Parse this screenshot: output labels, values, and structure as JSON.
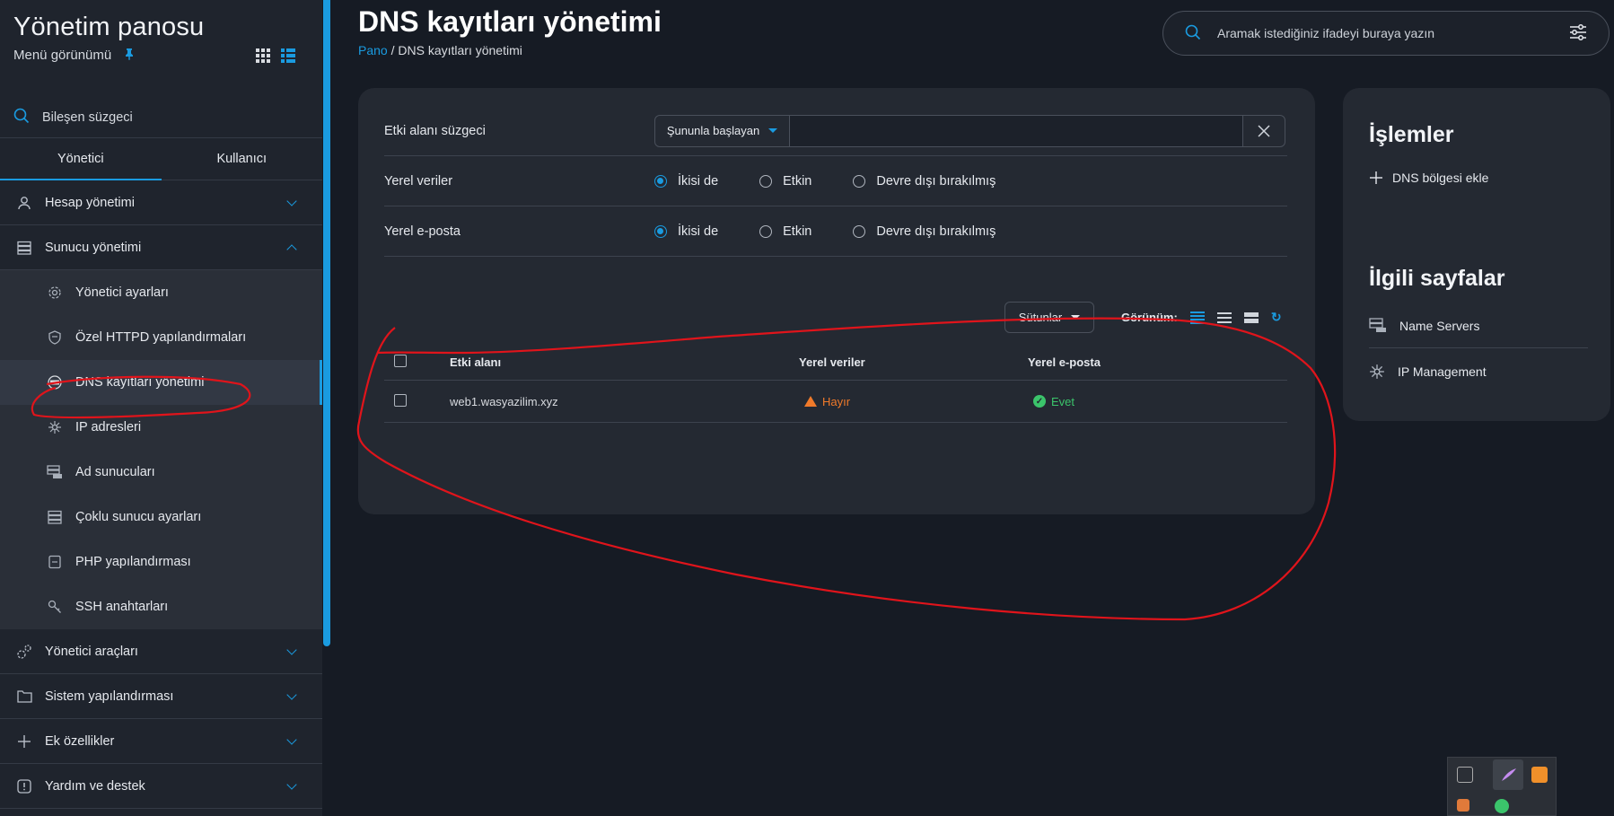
{
  "sidebar": {
    "title": "Yönetim panosu",
    "subtitle": "Menü görünümü",
    "filter_label": "Bileşen süzgeci",
    "tabs": [
      {
        "label": "Yönetici"
      },
      {
        "label": "Kullanıcı"
      }
    ],
    "sections_top": [
      {
        "label": "Hesap yönetimi"
      },
      {
        "label": "Sunucu yönetimi"
      }
    ],
    "sub_items": [
      {
        "label": "Yönetici ayarları"
      },
      {
        "label": "Özel HTTPD yapılandırmaları"
      },
      {
        "label": "DNS kayıtları yönetimi"
      },
      {
        "label": "IP adresleri"
      },
      {
        "label": "Ad sunucuları"
      },
      {
        "label": "Çoklu sunucu ayarları"
      },
      {
        "label": "PHP yapılandırması"
      },
      {
        "label": "SSH anahtarları"
      }
    ],
    "sections_bottom": [
      {
        "label": "Yönetici araçları"
      },
      {
        "label": "Sistem yapılandırması"
      },
      {
        "label": "Ek özellikler"
      },
      {
        "label": "Yardım ve destek"
      }
    ]
  },
  "header": {
    "title": "DNS kayıtları yönetimi",
    "breadcrumb_home": "Pano",
    "breadcrumb_sep": "/",
    "breadcrumb_current": "DNS kayıtları yönetimi",
    "search_placeholder": "Aramak istediğiniz ifadeyi buraya yazın"
  },
  "filters": {
    "domain_label": "Etki alanı süzgeci",
    "domain_mode": "Şununla başlayan",
    "domain_value": "",
    "local_data_label": "Yerel veriler",
    "local_mail_label": "Yerel e-posta",
    "opt_both": "İkisi de",
    "opt_active": "Etkin",
    "opt_disabled": "Devre dışı bırakılmış"
  },
  "toolbar": {
    "columns_label": "Sütunlar",
    "view_label": "Görünüm:"
  },
  "table": {
    "headers": [
      "Etki alanı",
      "Yerel veriler",
      "Yerel e-posta"
    ],
    "rows": [
      {
        "domain": "web1.wasyazilim.xyz",
        "local_data": "Hayır",
        "local_mail": "Evet"
      }
    ]
  },
  "right": {
    "actions_title": "İşlemler",
    "action_add": "DNS bölgesi ekle",
    "related_title": "İlgili sayfalar",
    "links": [
      {
        "label": "Name Servers"
      },
      {
        "label": "IP Management"
      }
    ]
  },
  "colors": {
    "accent": "#1a9be0",
    "no": "#f07a2a",
    "yes": "#3bc46b",
    "annotation": "#e0141b"
  }
}
